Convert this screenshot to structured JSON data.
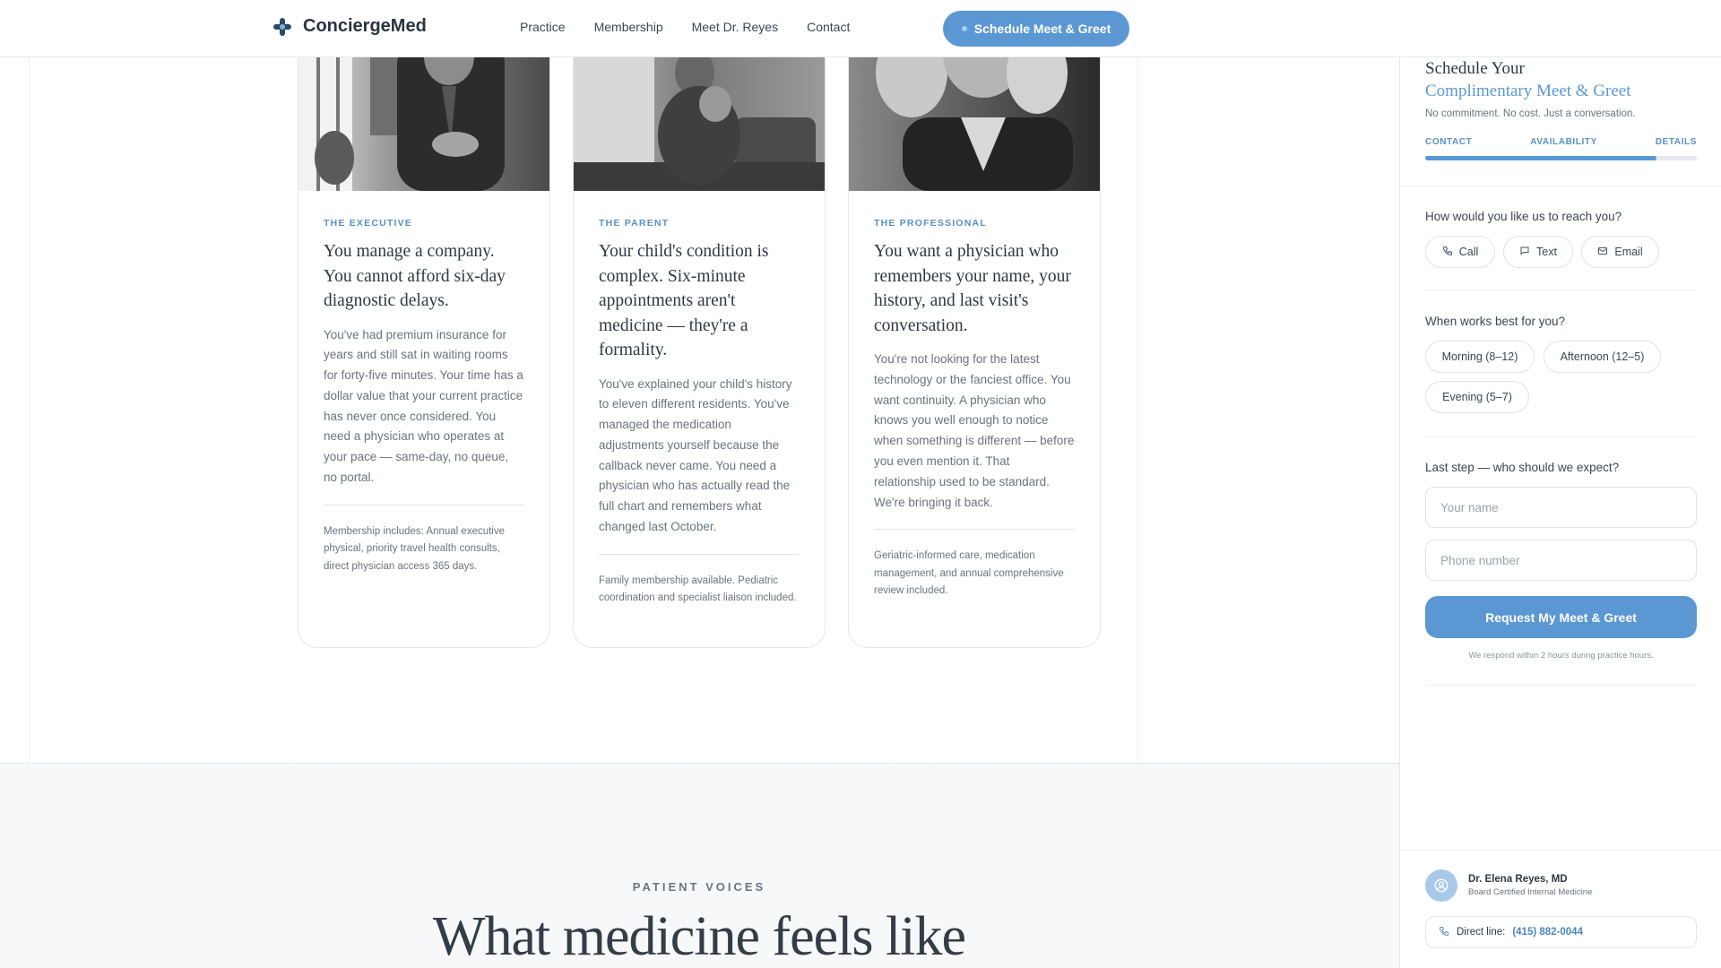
{
  "header": {
    "brand": "ConciergeMed",
    "nav": [
      "Practice",
      "Membership",
      "Meet Dr. Reyes",
      "Contact"
    ],
    "cta_label": "Schedule Meet & Greet"
  },
  "cards": [
    {
      "tag": "THE EXECUTIVE",
      "title": "You manage a company. You cannot afford six-day diagnostic delays.",
      "text": "You've had premium insurance for years and still sat in waiting rooms for forty-five minutes. Your time has a dollar value that your current practice has never once considered. You need a physician who operates at your pace — same-day, no queue, no portal.",
      "footer": "Membership includes: Annual executive physical, priority travel health consults, direct physician access 365 days."
    },
    {
      "tag": "THE PARENT",
      "title": "Your child's condition is complex. Six-minute appointments aren't medicine — they're a formality.",
      "text": "You've explained your child's history to eleven different residents. You've managed the medication adjustments yourself because the callback never came. You need a physician who has actually read the full chart and remembers what changed last October.",
      "footer": "Family membership available. Pediatric coordination and specialist liaison included."
    },
    {
      "tag": "THE PROFESSIONAL",
      "title": "You want a physician who remembers your name, your history, and last visit's conversation.",
      "text": "You're not looking for the latest technology or the fanciest office. You want continuity. A physician who knows you well enough to notice when something is different — before you even mention it. That relationship used to be standard. We're bringing it back.",
      "footer": "Geriatric-informed care, medication management, and annual comprehensive review included."
    }
  ],
  "voices": {
    "eyebrow": "PATIENT VOICES",
    "title": "What medicine feels like"
  },
  "panel": {
    "title_line1": "Schedule Your",
    "title_line2": "Complimentary Meet & Greet",
    "subtitle": "No commitment. No cost. Just a conversation.",
    "steps": [
      "CONTACT",
      "AVAILABILITY",
      "DETAILS"
    ],
    "progress": 0.85,
    "q_reach": "How would you like us to reach you?",
    "reach_options": [
      "Call",
      "Text",
      "Email"
    ],
    "q_time": "When works best for you?",
    "time_options": [
      "Morning (8–12)",
      "Afternoon (12–5)",
      "Evening (5–7)"
    ],
    "q_last": "Last step — who should we expect?",
    "name_placeholder": "Your name",
    "phone_placeholder": "Phone number",
    "submit_label": "Request My Meet & Greet",
    "note": "We respond within 2 hours during practice hours.",
    "doctor_name": "Dr. Elena Reyes, MD",
    "doctor_cred": "Board Certified Internal Medicine",
    "direct_label": "Direct line:",
    "direct_phone": "(415) 882-0044"
  },
  "colors": {
    "accent": "#5b97d3",
    "tag": "#5b8fc4",
    "text": "#2f3841"
  },
  "icons": [
    "cross-logo-icon",
    "phone-icon",
    "chat-bubble-icon",
    "mail-icon",
    "user-icon"
  ]
}
